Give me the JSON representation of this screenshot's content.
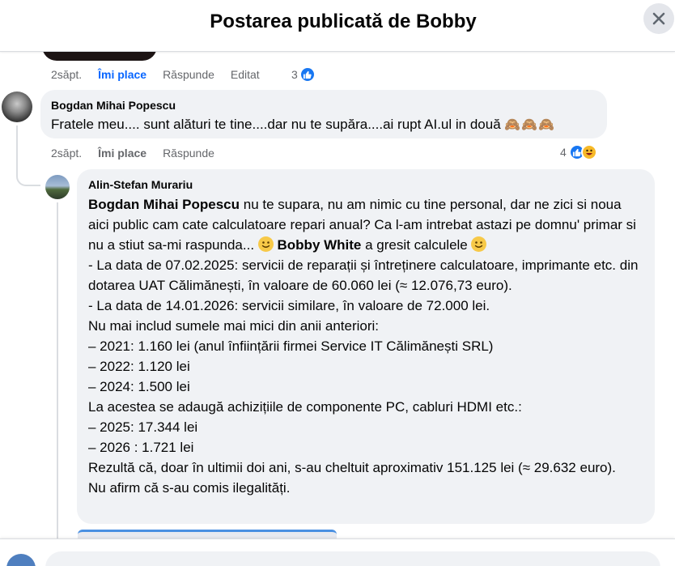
{
  "header": {
    "title": "Postarea publicată de Bobby"
  },
  "prev_comment": {
    "time": "2săpt.",
    "like_label": "Îmi place",
    "reply_label": "Răspunde",
    "edited_label": "Editat",
    "reaction_count": "3"
  },
  "comment1": {
    "author": "Bogdan Mihai Popescu",
    "text": "Fratele meu.... sunt alături te tine....dar nu te supăra....ai rupt AI.ul in două",
    "emojis": "🙈🙈🙈",
    "time": "2săpt.",
    "like_label": "Îmi place",
    "reply_label": "Răspunde",
    "reaction_count": "4"
  },
  "comment2": {
    "author": "Alin-Stefan Murariu",
    "mention1": "Bogdan Mihai Popescu",
    "line1_rest": " nu te supara, nu am nimic cu tine personal, dar ne zici si noua aici public cam cate calculatoare repari anual? Ca l-am intrebat astazi pe domnu' primar si nu a stiut sa-mi raspunda... ",
    "mention2": "Bobby White",
    "line1_end": " a gresit calculele ",
    "lines": [
      "- La data de 07.02.2025: servicii de reparații și întreținere calculatoare, imprimante etc. din dotarea UAT Călimănești, în valoare de 60.060 lei (≈ 12.076,73 euro).",
      "- La data de 14.01.2026: servicii similare, în valoare de 72.000 lei.",
      "Nu mai includ sumele mai mici din anii anteriori:",
      "– 2021: 1.160 lei (anul înființării firmei Service IT Călimănești SRL)",
      "– 2022: 1.120 lei",
      "– 2024: 1.500 lei",
      "La acestea se adaugă achizițiile de componente PC, cabluri HDMI etc.:",
      "– 2025: 17.344 lei",
      "– 2026 : 1.721 lei",
      "Rezultă că, doar în ultimii doi ani, s-au cheltuit aproximativ 151.125 lei (≈ 29.632 euro).",
      "Nu afirm că s-au comis ilegalități."
    ]
  },
  "colors": {
    "link_blue": "#0866ff",
    "bubble_bg": "#f0f2f5",
    "muted": "#65676b"
  },
  "icons": {
    "close": "close-icon",
    "like": "like-icon",
    "haha": "haha-icon",
    "smile": "smile-emoji-icon"
  }
}
